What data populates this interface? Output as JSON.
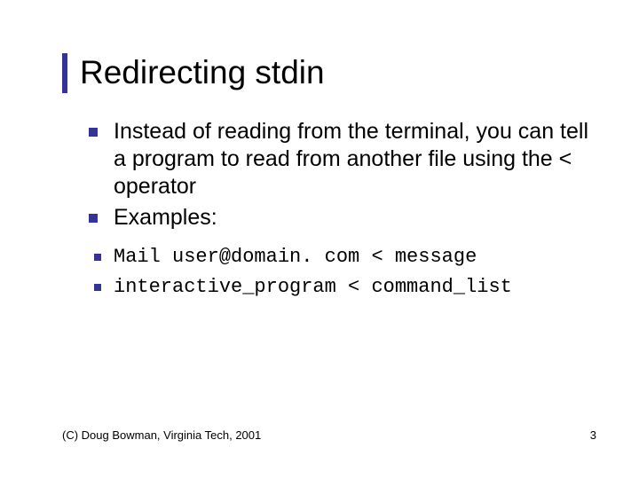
{
  "title": "Redirecting stdin",
  "bullets_l1": [
    "Instead of reading from the terminal, you can tell a program to read from another file using the < operator",
    "Examples:"
  ],
  "bullets_l2": [
    "Mail user@domain. com < message",
    "interactive_program < command_list"
  ],
  "footer": {
    "left": "(C) Doug Bowman, Virginia Tech, 2001",
    "right": "3"
  }
}
